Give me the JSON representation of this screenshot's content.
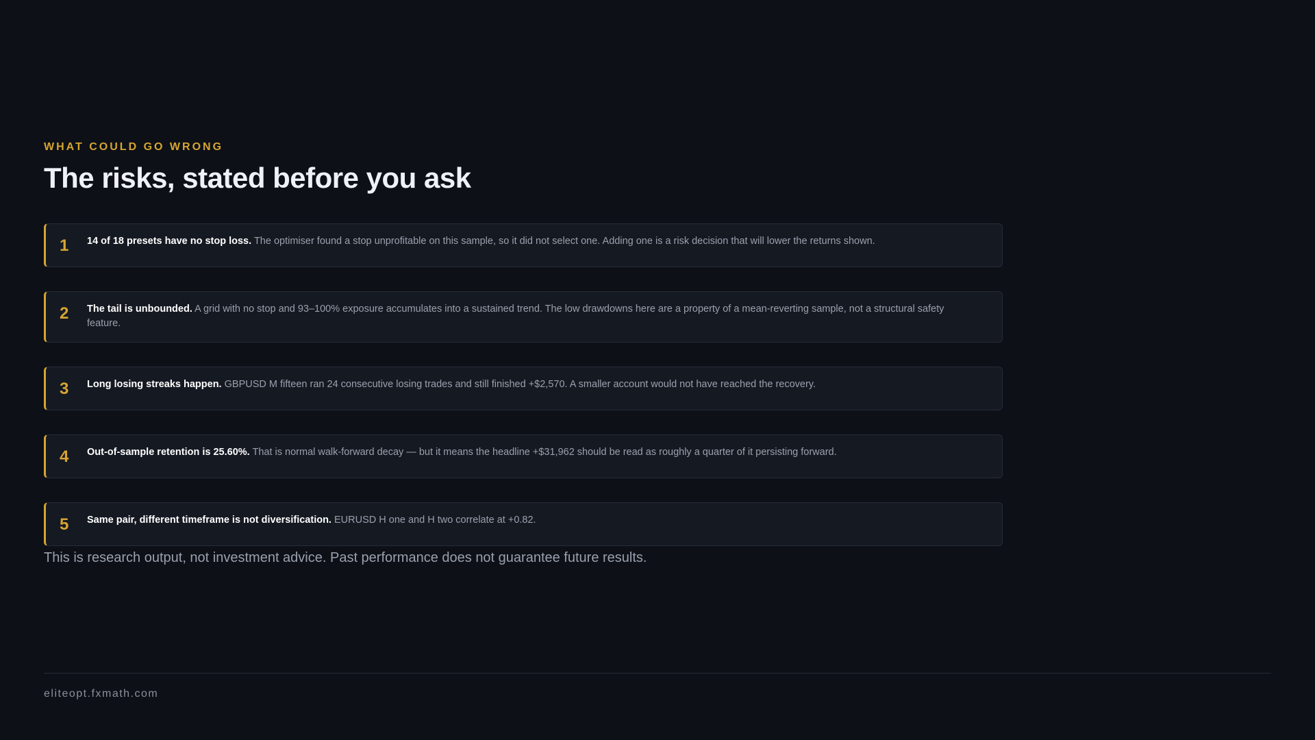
{
  "eyebrow": "WHAT COULD GO WRONG",
  "title": "The risks, stated before you ask",
  "risks": [
    {
      "number": "1",
      "lead": "14 of 18 presets have no stop loss.",
      "body": "The optimiser found a stop unprofitable on this sample, so it did not select one. Adding one is a risk decision that will lower the returns shown."
    },
    {
      "number": "2",
      "lead": "The tail is unbounded.",
      "body": "A grid with no stop and 93–100% exposure accumulates into a sustained trend. The low drawdowns here are a property of a mean-reverting sample, not a structural safety feature."
    },
    {
      "number": "3",
      "lead": "Long losing streaks happen.",
      "body": "GBPUSD M fifteen ran 24 consecutive losing trades and still finished +$2,570. A smaller account would not have reached the recovery."
    },
    {
      "number": "4",
      "lead": "Out-of-sample retention is 25.60%.",
      "body": "That is normal walk-forward decay — but it means the headline +$31,962 should be read as roughly a quarter of it persisting forward."
    },
    {
      "number": "5",
      "lead": "Same pair, different timeframe is not diversification.",
      "body": "EURUSD H one and H two correlate at +0.82."
    }
  ],
  "disclaimer": "This is research output, not investment advice. Past performance does not guarantee future results.",
  "footer": {
    "url": "eliteopt.fxmath.com"
  },
  "colors": {
    "background": "#0d1017",
    "accent": "#d6a531",
    "card": "#151922",
    "card_border": "#262b36",
    "heading": "#eef1f6",
    "muted": "#9aa1ad"
  }
}
